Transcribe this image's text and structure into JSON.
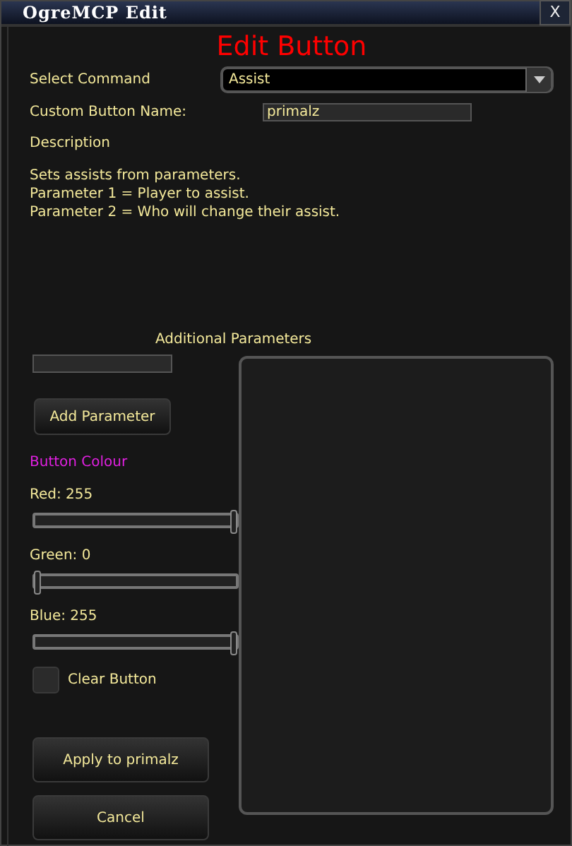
{
  "window": {
    "title": "OgreMCP Edit",
    "close": "X"
  },
  "heading": "Edit Button",
  "command": {
    "label": "Select Command",
    "value": "Assist"
  },
  "custom_name": {
    "label": "Custom Button Name:",
    "value": "primalz"
  },
  "description": {
    "label": "Description",
    "lines": [
      "Sets assists from parameters.",
      "Parameter 1 = Player to assist.",
      "Parameter 2 = Who will change their assist."
    ]
  },
  "additional_parameters": {
    "label": "Additional Parameters",
    "button": "Add Parameter"
  },
  "colour": {
    "label": "Button Colour",
    "channels": [
      {
        "label": "Red: 255",
        "level": 1
      },
      {
        "label": "Green: 0",
        "level": 0
      },
      {
        "label": "Blue: 255",
        "level": 1
      }
    ]
  },
  "clear_button": {
    "label": "Clear Button",
    "checked": false
  },
  "buttons": [
    "Apply to primalz",
    "Cancel"
  ]
}
